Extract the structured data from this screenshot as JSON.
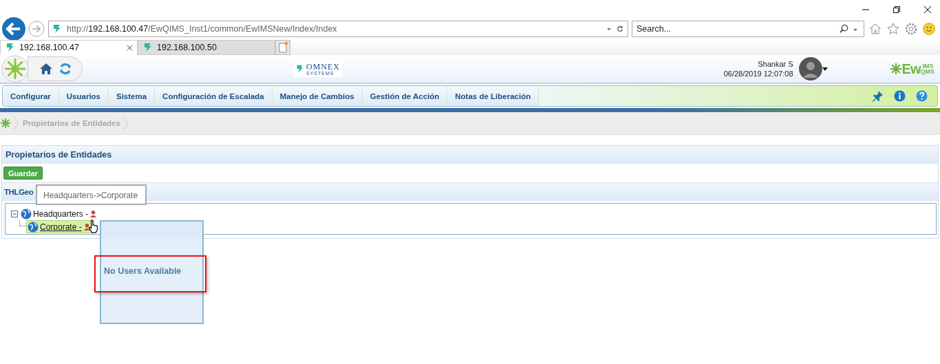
{
  "browser": {
    "address": {
      "scheme": "http://",
      "host": "192.168.100.47",
      "path": "/EwQIMS_Inst1/common/EwIMSNew/Index/Index"
    },
    "search": {
      "placeholder": "Search..."
    },
    "tabs": [
      {
        "label": "192.168.100.47",
        "selected": true
      },
      {
        "label": "192.168.100.50",
        "selected": false
      }
    ]
  },
  "header": {
    "omnex_logo": {
      "name": "OMNEX",
      "tagline": "SYSTEMS"
    },
    "user_name": "Shankar S",
    "datetime": "06/28/2019 12:07:08",
    "product_logo": {
      "main": "Ew",
      "top": "IMS",
      "bottom": "QMS"
    }
  },
  "nav": {
    "items": [
      {
        "label": "Configurar"
      },
      {
        "label": "Usuarios"
      },
      {
        "label": "Sistema"
      },
      {
        "label": "Configuración de Escalada"
      },
      {
        "label": "Manejo de Cambios"
      },
      {
        "label": "Gestión de Acción"
      },
      {
        "label": "Notas de Liberación"
      }
    ]
  },
  "breadcrumb": [
    "Propietarios de Entidades"
  ],
  "panel": {
    "title": "Propietarios de Entidades",
    "save_button": "Guardar",
    "section_title": "THLGeo",
    "tree": [
      {
        "label": "Headquarters -",
        "expanded": true,
        "selected": false,
        "children": [
          {
            "label": "Corporate -",
            "selected": true
          }
        ]
      }
    ]
  },
  "tooltip": "Headquarters->Corporate",
  "popup": {
    "message": "No Users Available"
  }
}
